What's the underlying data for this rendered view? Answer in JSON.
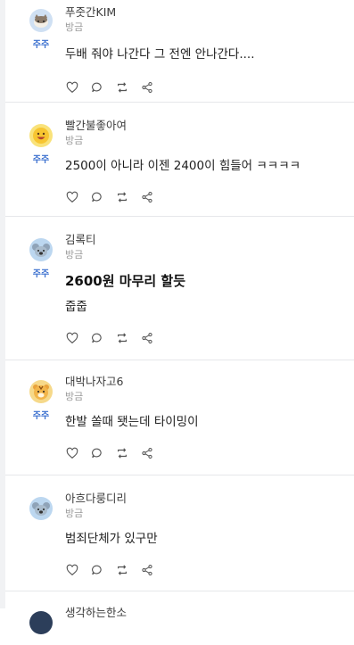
{
  "posts": [
    {
      "nickname": "푸줏간KIM",
      "time": "방금",
      "badge": "주주",
      "title": "",
      "body": "두배 줘야 나간다 그 전엔 안나간다....",
      "avatar": "cat-avatar",
      "avatar_bg": "#cfe0f3"
    },
    {
      "nickname": "빨간불좋아여",
      "time": "방금",
      "badge": "주주",
      "title": "",
      "body": "2500이 아니라 이젠 2400이 힘들어 ㅋㅋㅋㅋ",
      "avatar": "smile-avatar",
      "avatar_bg": "#f9e27a"
    },
    {
      "nickname": "김록티",
      "time": "방금",
      "badge": "주주",
      "title": "2600원 마무리 할듯",
      "body": "줍줍",
      "avatar": "koala-avatar",
      "avatar_bg": "#bcd7f0"
    },
    {
      "nickname": "대박나자고6",
      "time": "방금",
      "badge": "주주",
      "title": "",
      "body": "한발 쏠때 됏는데 타이밍이",
      "avatar": "tiger-avatar",
      "avatar_bg": "#f6d98a"
    },
    {
      "nickname": "아흐다룽디리",
      "time": "방금",
      "badge": "",
      "title": "",
      "body": "범죄단체가 있구만",
      "avatar": "koala-avatar",
      "avatar_bg": "#bcd7f0"
    },
    {
      "nickname": "생각하는한소",
      "time": "",
      "badge": "",
      "title": "",
      "body": "",
      "avatar": "dark-avatar",
      "avatar_bg": "#2c3e5a"
    }
  ],
  "actions": [
    "like-icon",
    "comment-icon",
    "repost-icon",
    "share-icon"
  ],
  "colors": {
    "badge": "#3a6fcf",
    "divider": "#e6e7ea",
    "icon": "#555555"
  }
}
